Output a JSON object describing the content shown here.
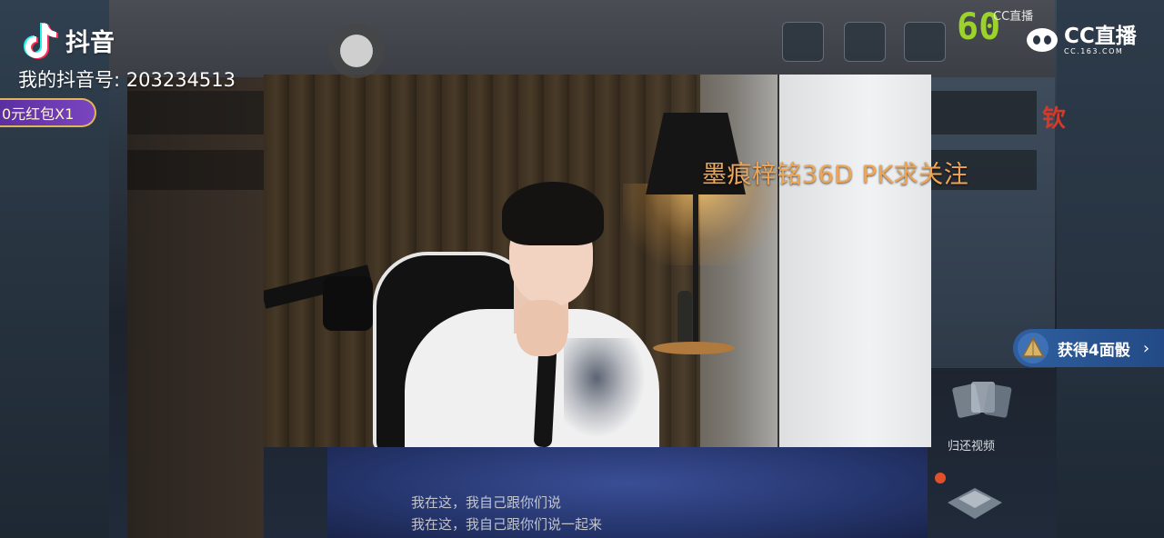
{
  "app": {
    "name": "抖音",
    "account_label": "我的抖音号: 203234513"
  },
  "red_packet": {
    "label": "0元红包X1"
  },
  "video": {
    "caption": "墨痕梓铭36D PK求关注"
  },
  "stream_logo": {
    "small_label": "CC直播",
    "main_label": "CC直播",
    "url": "CC.163.COM"
  },
  "fps_counter": "60",
  "side_edge_text": "钦",
  "reward": {
    "label": "获得4面骰",
    "arrow": "›"
  },
  "game_ui": {
    "button_label": "归还视频"
  },
  "chat": {
    "line1": "我在这，我自己跟你们说",
    "line2": "我在这，我自己跟你们说一起来"
  },
  "colors": {
    "caption": "#f0a552",
    "fps": "#9bd32a",
    "reward_bg": "#2f5fa0",
    "red_packet_bg": "#5a2fa0"
  }
}
